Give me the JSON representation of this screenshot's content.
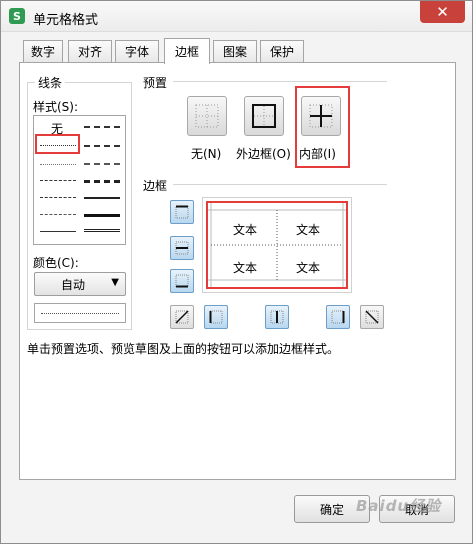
{
  "window": {
    "title": "单元格格式",
    "app_icon_letter": "S",
    "close_symbol": "✕"
  },
  "tabs": [
    {
      "label": "数字"
    },
    {
      "label": "对齐"
    },
    {
      "label": "字体"
    },
    {
      "label": "边框",
      "active": true
    },
    {
      "label": "图案"
    },
    {
      "label": "保护"
    }
  ],
  "line_group": {
    "title": "线条",
    "style_label": "样式(S):",
    "none_label": "无",
    "color_label": "颜色(C):",
    "color_value": "自动"
  },
  "presets": {
    "title": "预置",
    "none_label": "无(N)",
    "outline_label": "外边框(O)",
    "inside_label": "内部(I)"
  },
  "border": {
    "title": "边框",
    "cell_text": "文本"
  },
  "hint": "单击预置选项、预览草图及上面的按钮可以添加边框样式。",
  "buttons": {
    "ok": "确定",
    "cancel": "取消"
  },
  "watermark": "Baidu经验",
  "colors": {
    "highlight": "#e53b3b",
    "accent_blue": "#6c9ec7",
    "app_green": "#2e9a52"
  }
}
